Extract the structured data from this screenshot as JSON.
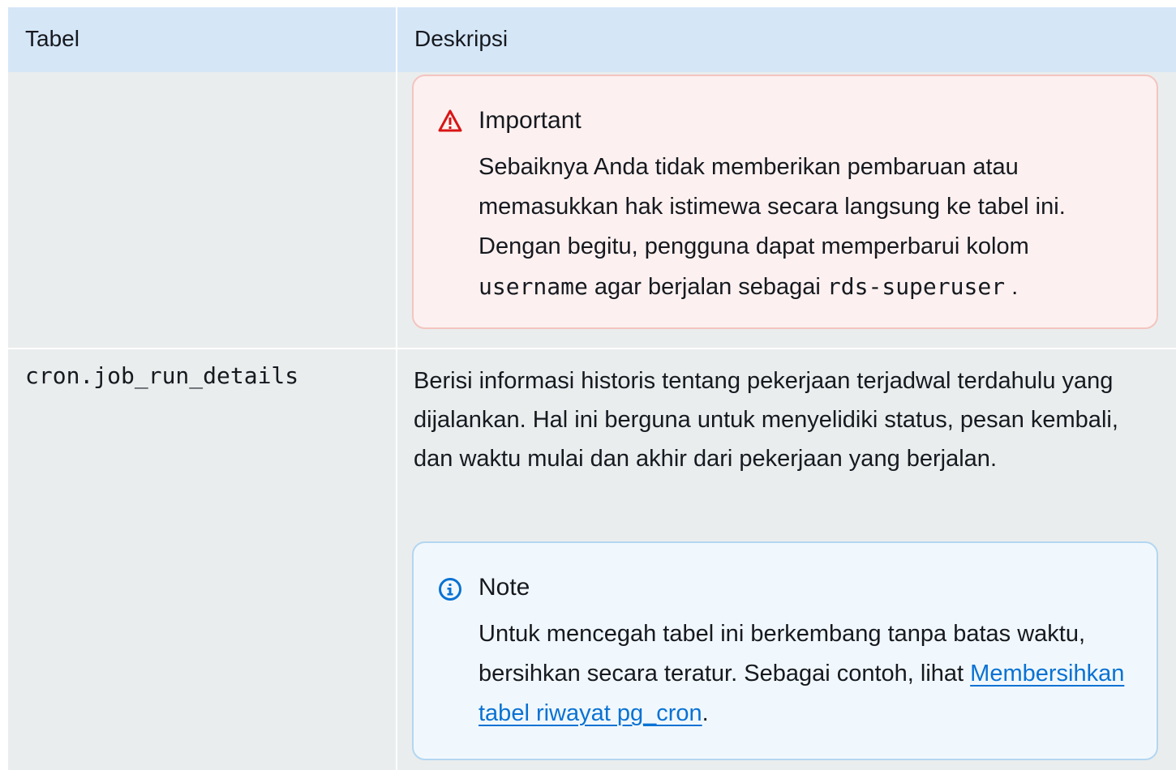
{
  "table": {
    "headers": [
      "Tabel",
      "Deskripsi"
    ],
    "rows": [
      {
        "name": "",
        "alert": {
          "type": "important",
          "icon": "warning-icon",
          "title": "Important",
          "text_1": "Sebaiknya Anda tidak memberikan pembaruan atau memasukkan hak istimewa secara langsung ke tabel ini. Dengan begitu, pengguna dapat memperbarui kolom ",
          "code_1": "username",
          "text_2": " agar berjalan sebagai ",
          "code_2": "rds-superuser",
          "text_3": " ."
        }
      },
      {
        "name": "cron.job_run_details",
        "description": "Berisi informasi historis tentang pekerjaan terjadwal terdahulu yang dijalankan. Hal ini berguna untuk menyelidiki status, pesan kembali, dan waktu mulai dan akhir dari pekerjaan yang berjalan.",
        "alert": {
          "type": "note",
          "icon": "info-icon",
          "title": "Note",
          "text_1": "Untuk mencegah tabel ini berkembang tanpa batas waktu, bersihkan secara teratur. Sebagai contoh, lihat ",
          "link": "Membersihkan tabel riwayat pg_cron",
          "text_2": "."
        }
      }
    ]
  },
  "colors": {
    "header_bg": "#d5e6f7",
    "row_bg": "#eaeded",
    "important_bg": "#fcf1f0",
    "important_border": "#f4c4c0",
    "important_icon": "#d91515",
    "note_bg": "#f1f8fd",
    "note_border": "#b3d6f1",
    "note_icon": "#0972d3",
    "link": "#0972d3"
  }
}
